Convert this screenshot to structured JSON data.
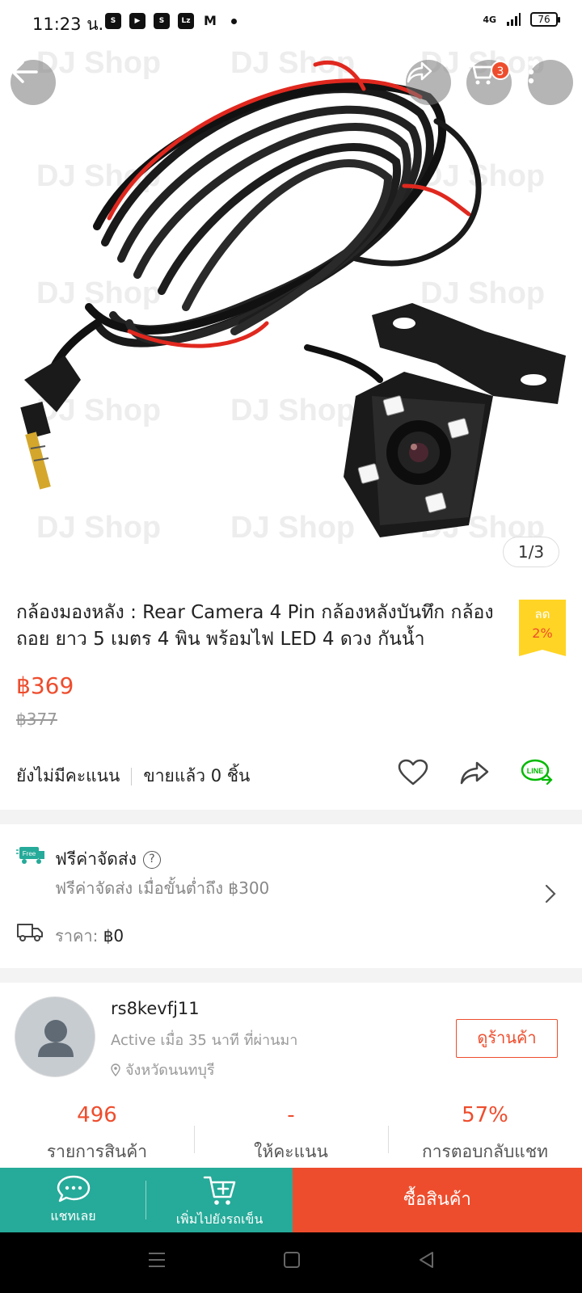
{
  "status_bar": {
    "time": "11:23 น.",
    "network": "4G",
    "battery": "76"
  },
  "image": {
    "counter": "1/3",
    "watermark": "DJ Shop"
  },
  "header": {
    "cart_count": "3"
  },
  "product": {
    "title": "กล้องมองหลัง : Rear Camera 4 Pin กล้องหลังบันทึก กล้องถอย ยาว 5 เมตร 4 พิน พร้อมไฟ LED 4 ดวง กันน้ำ",
    "discount_label": "ลด",
    "discount_value": "2%",
    "price": "฿369",
    "original_price": "฿377",
    "rating_text": "ยังไม่มีคะแนน",
    "sold_text": "ขายแล้ว 0 ชิ้น"
  },
  "shipping": {
    "free_badge": "Free",
    "title": "ฟรีค่าจัดส่ง",
    "subtitle": "ฟรีค่าจัดส่ง เมื่อขั้นต่ำถึง ฿300",
    "price_label": "ราคา:",
    "price_value": "฿0"
  },
  "shop": {
    "name": "rs8kevfj11",
    "active": "Active เมื่อ 35 นาที ที่ผ่านมา",
    "location": "จังหวัดนนทบุรี",
    "view_button": "ดูร้านค้า",
    "stats": [
      {
        "value": "496",
        "label": "รายการสินค้า"
      },
      {
        "value": "-",
        "label": "ให้คะแนน"
      },
      {
        "value": "57%",
        "label": "การตอบกลับแชท"
      }
    ]
  },
  "bottom_bar": {
    "chat_label": "แชทเลย",
    "add_cart_label": "เพิ่มไปยังรถเข็น",
    "buy_label": "ซื้อสินค้า"
  },
  "colors": {
    "accent": "#ee4d2d",
    "green": "#26aa99",
    "discount_yellow": "#ffd424"
  }
}
